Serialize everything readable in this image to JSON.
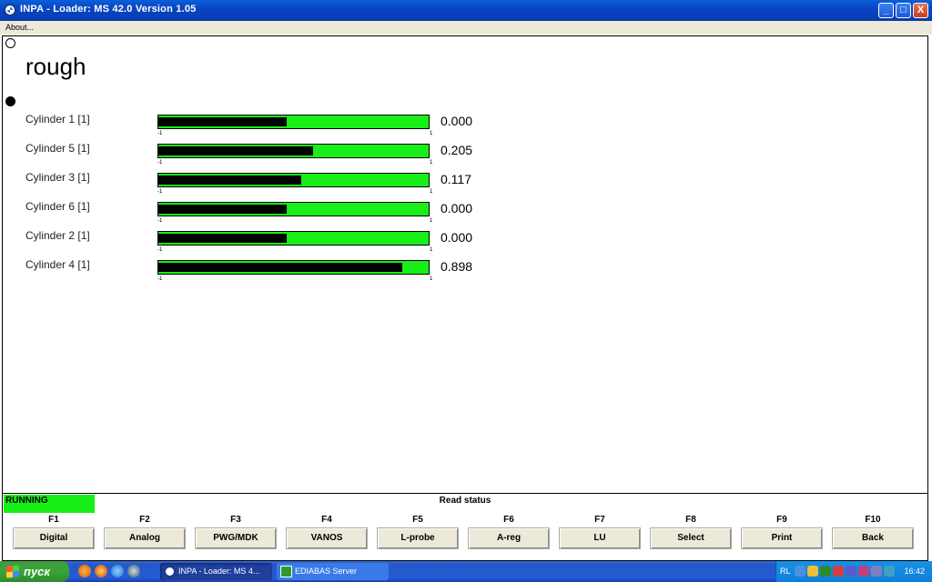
{
  "window": {
    "title": "INPA - Loader:  MS 42.0 Version 1.05",
    "menu": [
      "About..."
    ],
    "buttons": {
      "minimize": "_",
      "maximize": "□",
      "close": "X"
    }
  },
  "heading": "rough",
  "cylinders": [
    {
      "label": "Cylinder 1 [1]",
      "value": "0.000",
      "level": 0.5,
      "min": "-1",
      "max": "1"
    },
    {
      "label": "Cylinder 5 [1]",
      "value": "0.205",
      "level": 0.6025,
      "min": "-1",
      "max": "1"
    },
    {
      "label": "Cylinder 3 [1]",
      "value": "0.117",
      "level": 0.5585,
      "min": "-1",
      "max": "1"
    },
    {
      "label": "Cylinder 6 [1]",
      "value": "0.000",
      "level": 0.5,
      "min": "-1",
      "max": "1"
    },
    {
      "label": "Cylinder 2 [1]",
      "value": "0.000",
      "level": 0.5,
      "min": "-1",
      "max": "1"
    },
    {
      "label": "Cylinder 4 [1]",
      "value": "0.898",
      "level": 0.949,
      "min": "-1",
      "max": "1"
    }
  ],
  "status": {
    "running": "RUNNING",
    "label": "Read status"
  },
  "fkeys": [
    {
      "key": "F1",
      "label": "Digital"
    },
    {
      "key": "F2",
      "label": "Analog"
    },
    {
      "key": "F3",
      "label": "PWG/MDK"
    },
    {
      "key": "F4",
      "label": "VANOS"
    },
    {
      "key": "F5",
      "label": "L-probe"
    },
    {
      "key": "F6",
      "label": "A-reg"
    },
    {
      "key": "F7",
      "label": "LU"
    },
    {
      "key": "F8",
      "label": "Select"
    },
    {
      "key": "F9",
      "label": "Print"
    },
    {
      "key": "F10",
      "label": "Back"
    }
  ],
  "taskbar": {
    "start": "пуск",
    "tasks": [
      "INPA - Loader:  MS 4...",
      "EDIABAS Server"
    ],
    "lang": "RL",
    "clock": "16:42"
  },
  "colors": {
    "bar_green": "#18ee18",
    "bar_fill": "#000000",
    "title_blue": "#0845c4"
  }
}
